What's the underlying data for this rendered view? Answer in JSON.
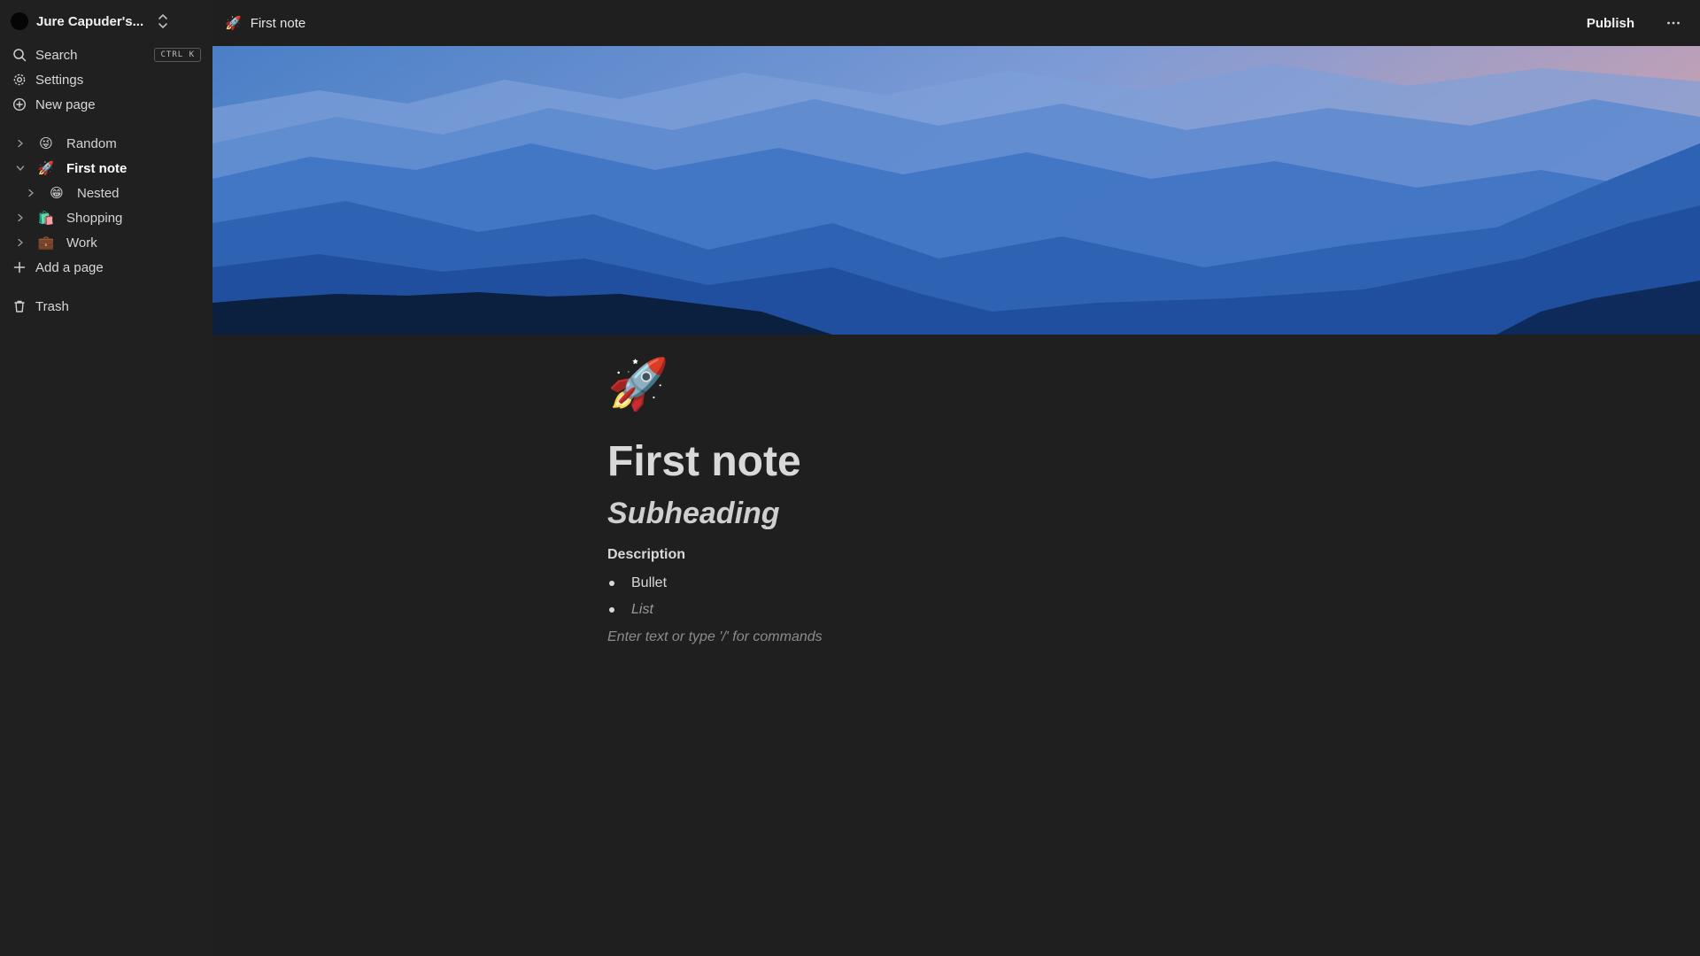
{
  "workspace": {
    "name": "Jure Capuder's..."
  },
  "nav": {
    "search": "Search",
    "search_shortcut": "CTRL K",
    "settings": "Settings",
    "new_page": "New page"
  },
  "tree": [
    {
      "emoji": "😜",
      "label": "Random"
    },
    {
      "emoji": "🚀",
      "label": "First note"
    },
    {
      "emoji": "😁",
      "label": "Nested"
    },
    {
      "emoji": "🛍️",
      "label": "Shopping"
    },
    {
      "emoji": "💼",
      "label": "Work"
    }
  ],
  "add_page": "Add a page",
  "trash": "Trash",
  "topbar": {
    "breadcrumb_emoji": "🚀",
    "breadcrumb": "First note",
    "publish": "Publish"
  },
  "page": {
    "icon": "🚀",
    "title": "First note",
    "subheading": "Subheading",
    "description": "Description",
    "bullets": [
      "Bullet",
      "List"
    ],
    "placeholder": "Enter text or type '/' for commands"
  },
  "colors": {
    "background": "#1f1f1f",
    "sidebar": "#202020"
  },
  "icons": [
    "search-icon",
    "gear-icon",
    "plus-circle-icon",
    "chevron-right-icon",
    "chevron-down-icon",
    "plus-icon",
    "trash-icon",
    "more-icon",
    "switch-icon"
  ]
}
